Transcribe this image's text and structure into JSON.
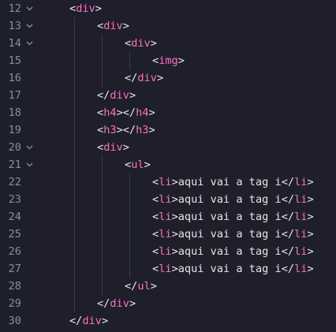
{
  "editor": {
    "lines": [
      {
        "number": "12",
        "fold": true,
        "indent": 1,
        "open": "<",
        "tag": "div",
        "close": ">",
        "text": "",
        "close_open": "",
        "close_tag": "",
        "close_close": ""
      },
      {
        "number": "13",
        "fold": true,
        "indent": 2,
        "open": "<",
        "tag": "div",
        "close": ">",
        "text": "",
        "close_open": "",
        "close_tag": "",
        "close_close": ""
      },
      {
        "number": "14",
        "fold": true,
        "indent": 3,
        "open": "<",
        "tag": "div",
        "close": ">",
        "text": "",
        "close_open": "",
        "close_tag": "",
        "close_close": ""
      },
      {
        "number": "15",
        "fold": false,
        "indent": 4,
        "open": "<",
        "tag": "img",
        "close": ">",
        "text": "",
        "close_open": "",
        "close_tag": "",
        "close_close": ""
      },
      {
        "number": "16",
        "fold": false,
        "indent": 3,
        "open": "</",
        "tag": "div",
        "close": ">",
        "text": "",
        "close_open": "",
        "close_tag": "",
        "close_close": ""
      },
      {
        "number": "17",
        "fold": false,
        "indent": 2,
        "open": "</",
        "tag": "div",
        "close": ">",
        "text": "",
        "close_open": "",
        "close_tag": "",
        "close_close": ""
      },
      {
        "number": "18",
        "fold": false,
        "indent": 2,
        "open": "<",
        "tag": "h4",
        "close": ">",
        "text": "",
        "close_open": "</",
        "close_tag": "h4",
        "close_close": ">"
      },
      {
        "number": "19",
        "fold": false,
        "indent": 2,
        "open": "<",
        "tag": "h3",
        "close": ">",
        "text": "",
        "close_open": "</",
        "close_tag": "h3",
        "close_close": ">"
      },
      {
        "number": "20",
        "fold": true,
        "indent": 2,
        "open": "<",
        "tag": "div",
        "close": ">",
        "text": "",
        "close_open": "",
        "close_tag": "",
        "close_close": ""
      },
      {
        "number": "21",
        "fold": true,
        "indent": 3,
        "open": "<",
        "tag": "ul",
        "close": ">",
        "text": "",
        "close_open": "",
        "close_tag": "",
        "close_close": ""
      },
      {
        "number": "22",
        "fold": false,
        "indent": 4,
        "open": "<",
        "tag": "li",
        "close": ">",
        "text": "aqui vai a tag i",
        "close_open": "</",
        "close_tag": "li",
        "close_close": ">"
      },
      {
        "number": "23",
        "fold": false,
        "indent": 4,
        "open": "<",
        "tag": "li",
        "close": ">",
        "text": "aqui vai a tag i",
        "close_open": "</",
        "close_tag": "li",
        "close_close": ">"
      },
      {
        "number": "24",
        "fold": false,
        "indent": 4,
        "open": "<",
        "tag": "li",
        "close": ">",
        "text": "aqui vai a tag i",
        "close_open": "</",
        "close_tag": "li",
        "close_close": ">"
      },
      {
        "number": "25",
        "fold": false,
        "indent": 4,
        "open": "<",
        "tag": "li",
        "close": ">",
        "text": "aqui vai a tag i",
        "close_open": "</",
        "close_tag": "li",
        "close_close": ">"
      },
      {
        "number": "26",
        "fold": false,
        "indent": 4,
        "open": "<",
        "tag": "li",
        "close": ">",
        "text": "aqui vai a tag i",
        "close_open": "</",
        "close_tag": "li",
        "close_close": ">"
      },
      {
        "number": "27",
        "fold": false,
        "indent": 4,
        "open": "<",
        "tag": "li",
        "close": ">",
        "text": "aqui vai a tag i",
        "close_open": "</",
        "close_tag": "li",
        "close_close": ">"
      },
      {
        "number": "28",
        "fold": false,
        "indent": 3,
        "open": "</",
        "tag": "ul",
        "close": ">",
        "text": "",
        "close_open": "",
        "close_tag": "",
        "close_close": ""
      },
      {
        "number": "29",
        "fold": false,
        "indent": 2,
        "open": "</",
        "tag": "div",
        "close": ">",
        "text": "",
        "close_open": "",
        "close_tag": "",
        "close_close": ""
      },
      {
        "number": "30",
        "fold": false,
        "indent": 1,
        "open": "</",
        "tag": "div",
        "close": ">",
        "text": "",
        "close_open": "",
        "close_tag": "",
        "close_close": ""
      }
    ],
    "colors": {
      "background": "#1e1f2a",
      "line_number": "#8a8d9c",
      "tag_name": "#ff6ec7",
      "bracket": "#e6e6e6",
      "text": "#e6e6e6",
      "fold_icon": "#8a8d9c",
      "indent_guide": "#3a3c4a"
    },
    "fold_icon_name": "chevron-down-icon"
  }
}
